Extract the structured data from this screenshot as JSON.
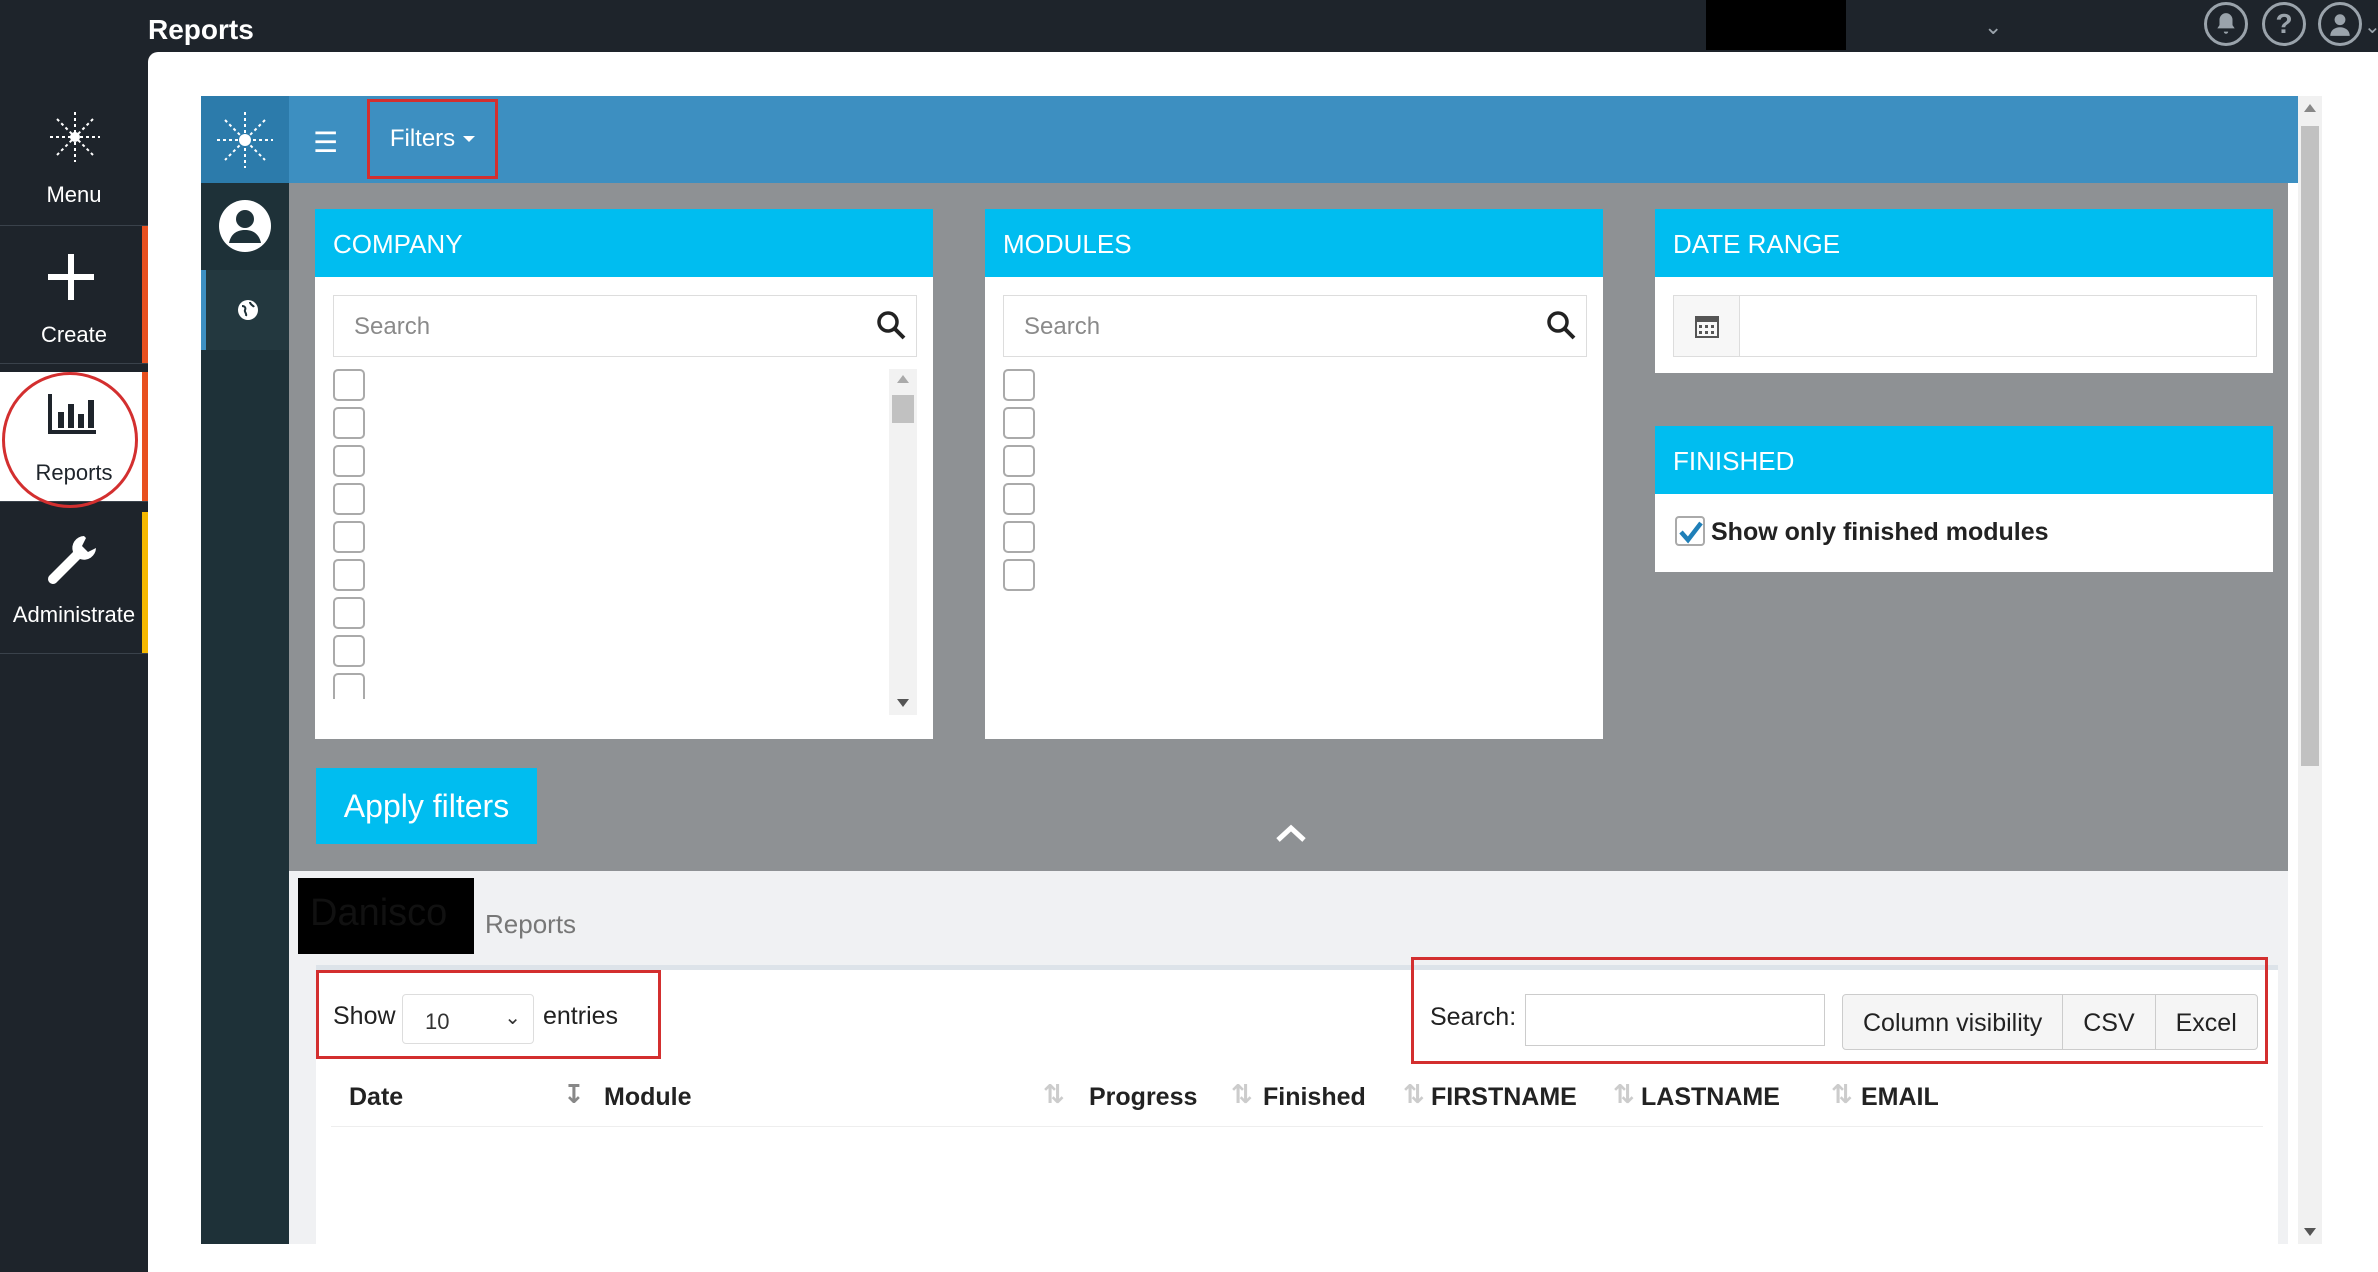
{
  "app": {
    "title": "Reports"
  },
  "nav": {
    "items": [
      {
        "label": "Menu",
        "icon": "snowflake-icon"
      },
      {
        "label": "Create",
        "icon": "plus-icon",
        "accent": "#e8501f"
      },
      {
        "label": "Reports",
        "icon": "bar-chart-icon",
        "accent": "#e8501f"
      },
      {
        "label": "Administrate",
        "icon": "wrench-icon",
        "accent": "#f5b800"
      }
    ]
  },
  "toolbar": {
    "filters_label": "Filters"
  },
  "filters": {
    "company": {
      "title": "COMPANY",
      "search_placeholder": "Search"
    },
    "modules": {
      "title": "MODULES",
      "search_placeholder": "Search"
    },
    "date_range": {
      "title": "DATE RANGE"
    },
    "finished": {
      "title": "FINISHED",
      "option_label": "Show only finished modules",
      "checked": true
    },
    "apply_label": "Apply filters"
  },
  "brand": {
    "name": "Danisco"
  },
  "breadcrumb": {
    "current": "Reports"
  },
  "table": {
    "show_label": "Show",
    "page_length": "10",
    "entries_label": "entries",
    "search_label": "Search:",
    "buttons": {
      "column_visibility": "Column visibility",
      "csv": "CSV",
      "excel": "Excel"
    },
    "columns": [
      "Date",
      "Module",
      "Progress",
      "Finished",
      "FIRSTNAME",
      "LASTNAME",
      "EMAIL"
    ]
  },
  "colors": {
    "header_blue": "#3d8fc1",
    "cyan": "#00bdf0",
    "highlight_red": "#d32f2f"
  }
}
